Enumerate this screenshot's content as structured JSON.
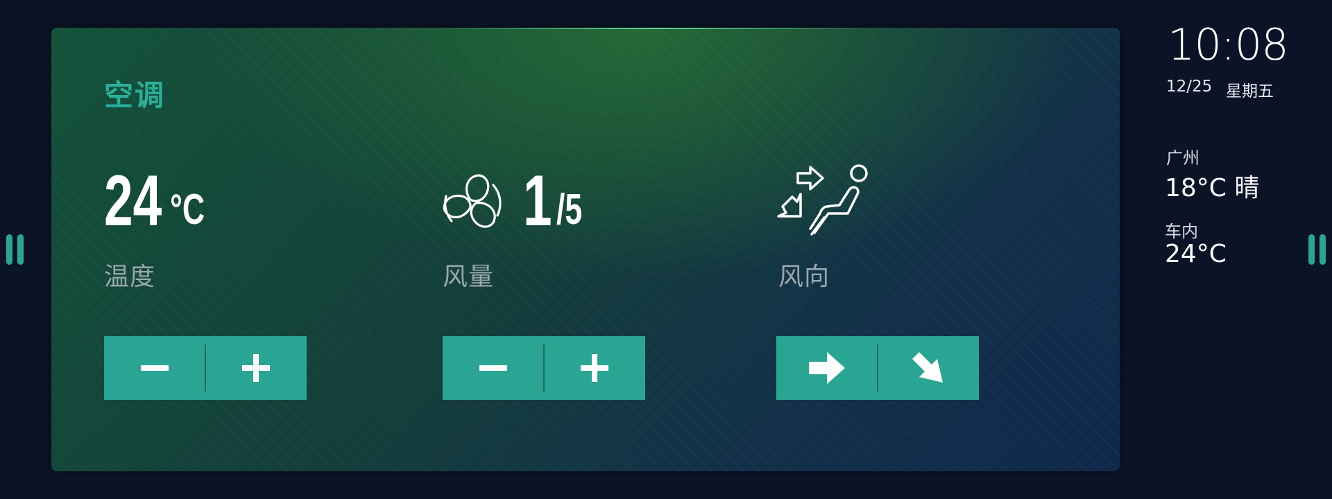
{
  "panel": {
    "title": "空调"
  },
  "temperature": {
    "value": "24",
    "unit": "°C",
    "label": "温度",
    "decrease_label": "−",
    "increase_label": "+"
  },
  "fan": {
    "value": "1",
    "max": "/5",
    "label": "风量",
    "icon": "fan-icon"
  },
  "airflow": {
    "label": "风向",
    "icon": "seat-airflow-icon",
    "buttons": [
      "arrow-right-icon",
      "arrow-down-right-icon"
    ]
  },
  "status": {
    "time": "10:08",
    "date": "12/25",
    "weekday": "星期五",
    "city": "广州",
    "weather": "18°C 晴",
    "inside_label": "车内",
    "inside_temp": "24°C"
  },
  "colors": {
    "accent": "#2aa593",
    "background": "#0b1427",
    "label": "#9aa7ad"
  }
}
